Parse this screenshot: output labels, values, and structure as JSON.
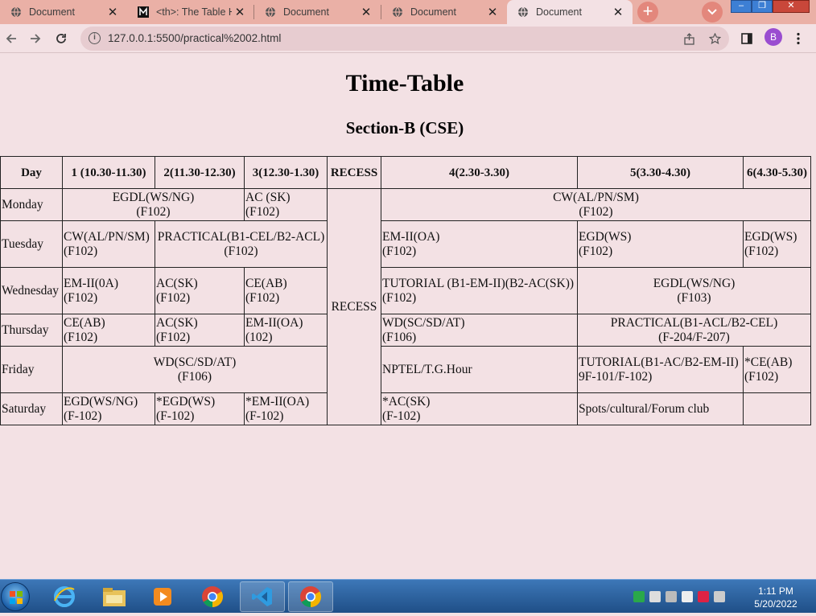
{
  "browser": {
    "tabs": [
      {
        "title": "Document",
        "icon": "globe-icon"
      },
      {
        "title": "<th>: The Table H",
        "icon": "mdn-icon"
      },
      {
        "title": "Document",
        "icon": "globe-icon"
      },
      {
        "title": "Document",
        "icon": "globe-icon"
      },
      {
        "title": "Document",
        "icon": "globe-icon"
      }
    ],
    "new_tab_label": "+",
    "url": "127.0.0.1:5500/practical%2002.html",
    "profile_initial": "B",
    "colors": {
      "tabbar": "#eab0a6",
      "active_tab": "#f3e1e4",
      "omnibox": "#e7ccd0",
      "avatar": "#9a4dd0"
    }
  },
  "page": {
    "title": "Time-Table",
    "subtitle": "Section-B (CSE)",
    "background": "#f3e1e4",
    "table": {
      "headers": [
        "Day",
        "1 (10.30-11.30)",
        "2(11.30-12.30)",
        "3(12.30-1.30)",
        "RECESS",
        "4(2.30-3.30)",
        "5(3.30-4.30)",
        "6(4.30-5.30)"
      ],
      "recess": "RECESS",
      "monday": {
        "day": "Monday",
        "p12": [
          "EGDL(WS/NG)",
          "(F102)"
        ],
        "p3": [
          "AC (SK)",
          "(F102)"
        ],
        "p456": [
          "CW(AL/PN/SM)",
          "(F102)"
        ]
      },
      "tuesday": {
        "day": "Tuesday",
        "p1": [
          "CW(AL/PN/SM)",
          "(F102)"
        ],
        "p23": [
          "PRACTICAL(B1-CEL/B2-ACL)",
          "(F102)"
        ],
        "p4": [
          "EM-II(OA)",
          "(F102)"
        ],
        "p5": [
          "EGD(WS)",
          "(F102)"
        ],
        "p6": [
          "EGD(WS)",
          "(F102)"
        ]
      },
      "wednesday": {
        "day": "Wednesday",
        "p1": [
          "EM-II(0A)",
          "(F102)"
        ],
        "p2": [
          "AC(SK)",
          "(F102)"
        ],
        "p3": [
          "CE(AB)",
          "(F102)"
        ],
        "p4": [
          "TUTORIAL (B1-EM-II)(B2-AC(SK))",
          "(F102)"
        ],
        "p56": [
          "EGDL(WS/NG)",
          "(F103)"
        ]
      },
      "thursday": {
        "day": "Thursday",
        "p1": [
          "CE(AB)",
          "(F102)"
        ],
        "p2": [
          "AC(SK)",
          "(F102)"
        ],
        "p3": [
          "EM-II(OA)",
          "(102)"
        ],
        "p4": [
          "WD(SC/SD/AT)",
          "(F106)"
        ],
        "p56": [
          "PRACTICAL(B1-ACL/B2-CEL)",
          "(F-204/F-207)"
        ]
      },
      "friday": {
        "day": "Friday",
        "p123": [
          "WD(SC/SD/AT)",
          "(F106)"
        ],
        "p4": "NPTEL/T.G.Hour",
        "p5": [
          "TUTORIAL(B1-AC/B2-EM-II)",
          "9F-101/F-102)"
        ],
        "p6": [
          "*CE(AB)",
          "(F102)"
        ]
      },
      "saturday": {
        "day": "Saturday",
        "p1": [
          "EGD(WS/NG)",
          "(F-102)"
        ],
        "p2": [
          "*EGD(WS)",
          "(F-102)"
        ],
        "p3": [
          "*EM-II(OA)",
          "(F-102)"
        ],
        "p4": [
          "*AC(SK)",
          "(F-102)"
        ],
        "p5": "Spots/cultural/Forum club",
        "p6": ""
      }
    }
  },
  "taskbar": {
    "apps": [
      "internet-explorer-icon",
      "file-explorer-icon",
      "media-player-icon",
      "chrome-icon",
      "vscode-icon",
      "chrome-icon"
    ],
    "time": "1:11 PM",
    "date": "5/20/2022"
  }
}
